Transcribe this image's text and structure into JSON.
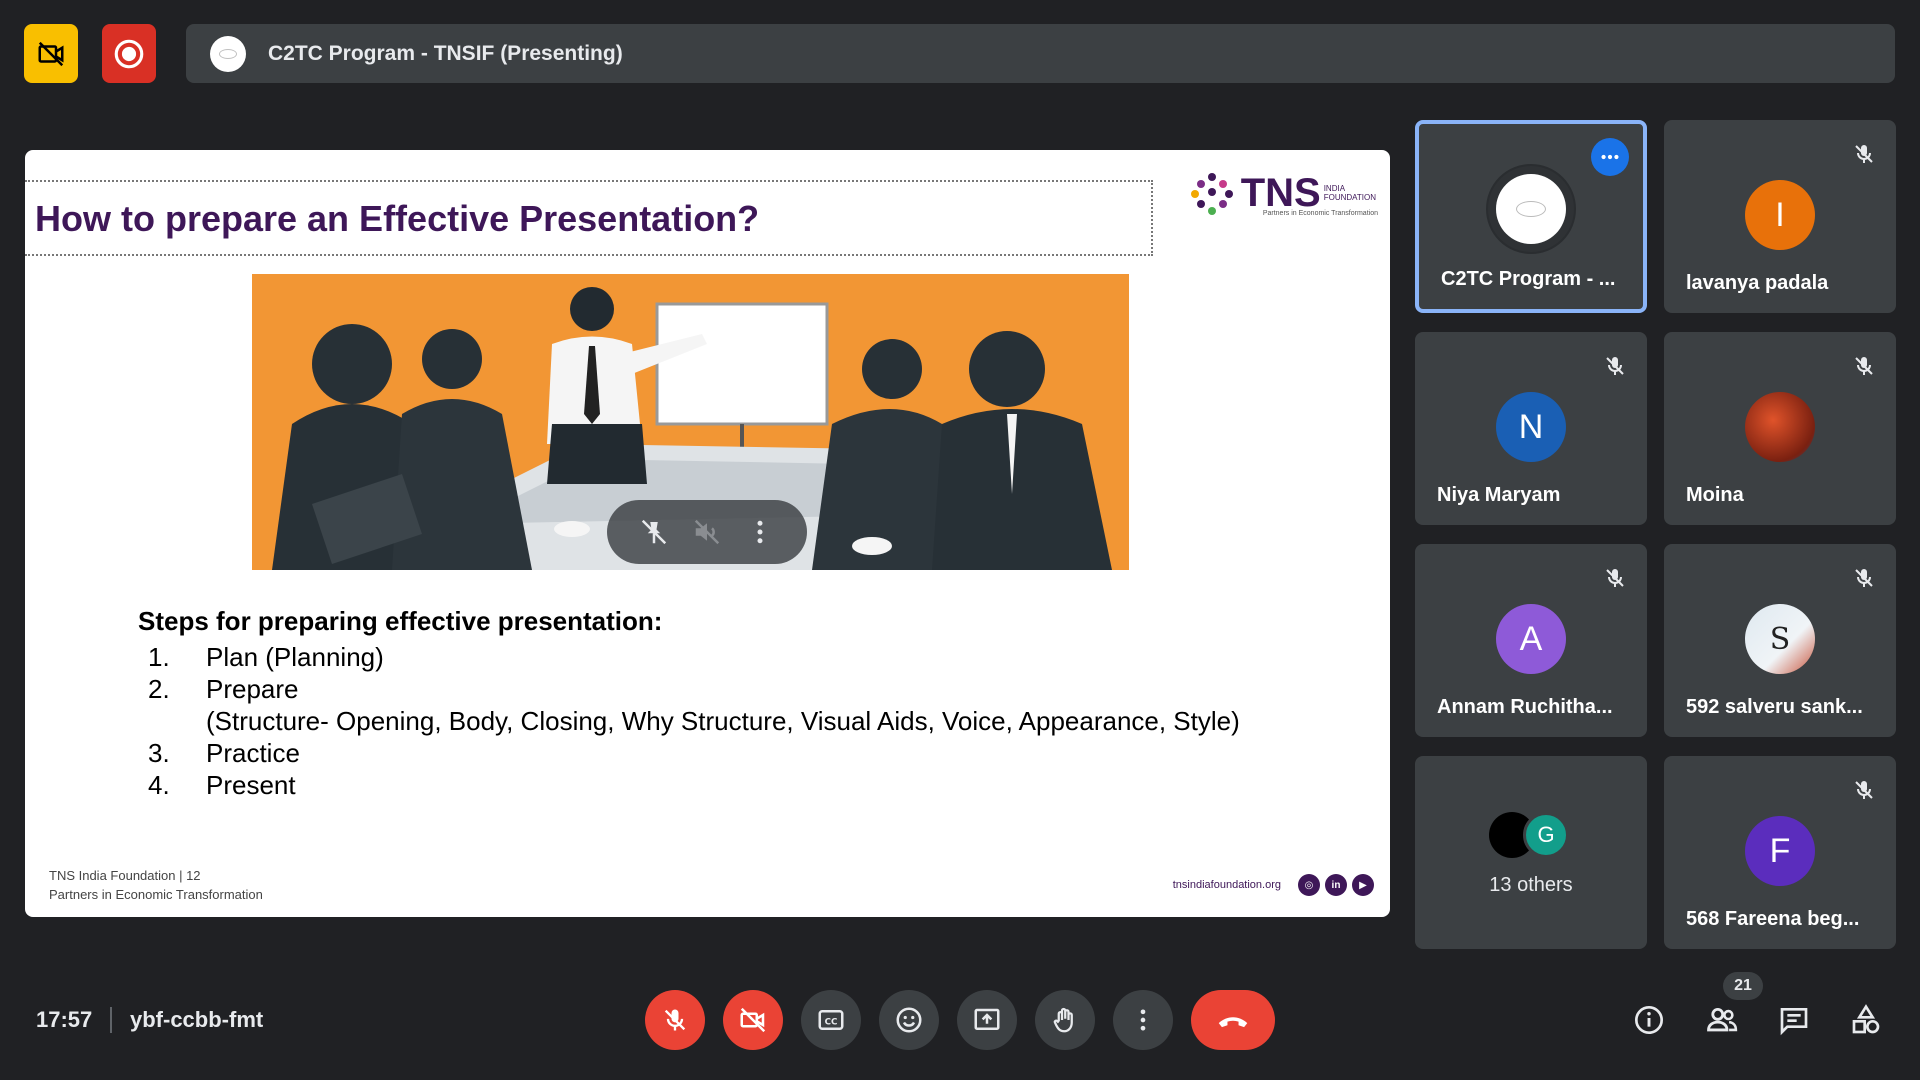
{
  "meeting": {
    "title": "C2TC Program - TNSIF (Presenting)",
    "time": "17:57",
    "code": "ybf-ccbb-fmt",
    "participant_count": "21"
  },
  "slide": {
    "title": "How to prepare an Effective Presentation?",
    "logo_text": "TNS",
    "logo_side_1": "INDIA",
    "logo_side_2": "FOUNDATION",
    "logo_tagline": "Partners in Economic Transformation",
    "steps_heading": "Steps for preparing effective presentation:",
    "steps": [
      {
        "num": "1.",
        "text": "Plan (Planning)"
      },
      {
        "num": "2.",
        "text": "Prepare"
      },
      {
        "num": "",
        "text": "(Structure- Opening, Body, Closing, Why Structure, Visual Aids, Voice, Appearance, Style)"
      },
      {
        "num": "3.",
        "text": "Practice"
      },
      {
        "num": "4.",
        "text": "Present"
      }
    ],
    "footer_line1": "TNS India Foundation | 12",
    "footer_line2": "Partners in Economic Transformation",
    "website": "tnsindiafoundation.org",
    "social_in": "in"
  },
  "participants": [
    {
      "name": "C2TC Program - ...",
      "initial": "",
      "color": "#ffffff",
      "active": true
    },
    {
      "name": "lavanya padala",
      "initial": "I",
      "color": "#e8710a"
    },
    {
      "name": "Niya Maryam",
      "initial": "N",
      "color": "#1a5fb4"
    },
    {
      "name": "Moina",
      "initial": "",
      "color": "#b5492a"
    },
    {
      "name": "Annam Ruchitha...",
      "initial": "A",
      "color": "#8e5ad8"
    },
    {
      "name": "592 salveru sank...",
      "initial": "",
      "color": "#dfe9f0"
    },
    {
      "name": "13 others",
      "initial": "G",
      "color": "#129e8b"
    },
    {
      "name": "568 Fareena beg...",
      "initial": "F",
      "color": "#5b2dbd"
    }
  ],
  "colors": {
    "accent": "#8ab4f8",
    "danger": "#ea4335",
    "brand_purple": "#3e1758",
    "slide_image_bg": "#f29634"
  },
  "icons": [
    "camera-off-icon",
    "record-icon",
    "mic-off-icon",
    "video-off-icon",
    "captions-icon",
    "emoji-icon",
    "present-icon",
    "raise-hand-icon",
    "more-vert-icon",
    "end-call-icon",
    "info-icon",
    "people-icon",
    "chat-icon",
    "activities-icon",
    "pin-off-icon",
    "volume-off-icon"
  ]
}
